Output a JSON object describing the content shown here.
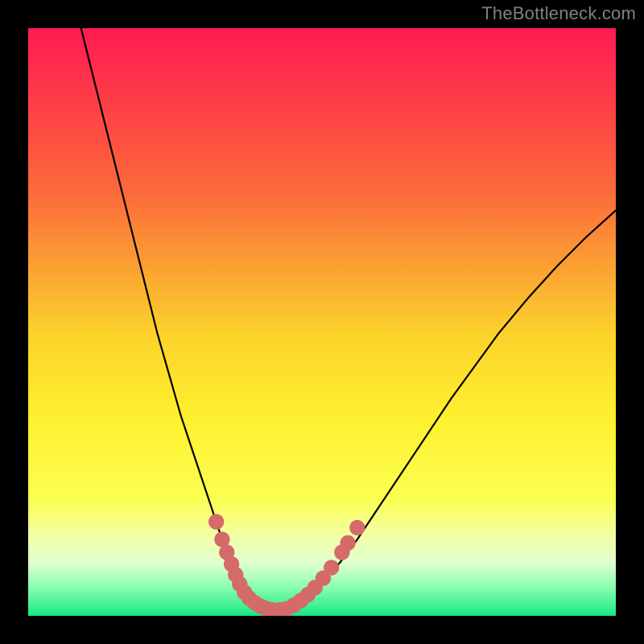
{
  "watermark": "TheBottleneck.com",
  "chart_data": {
    "type": "line",
    "title": "",
    "xlabel": "",
    "ylabel": "",
    "xlim": [
      0,
      100
    ],
    "ylim": [
      0,
      100
    ],
    "grid": false,
    "legend": false,
    "background_gradient": {
      "stops": [
        {
          "pos": 0.0,
          "color": "#ff1a52"
        },
        {
          "pos": 0.28,
          "color": "#fc6a3a"
        },
        {
          "pos": 0.52,
          "color": "#fcd22b"
        },
        {
          "pos": 0.66,
          "color": "#ffef2e"
        },
        {
          "pos": 0.8,
          "color": "#fbff50"
        },
        {
          "pos": 0.86,
          "color": "#f4ffa0"
        },
        {
          "pos": 0.91,
          "color": "#e0ffd0"
        },
        {
          "pos": 0.95,
          "color": "#8cffb0"
        },
        {
          "pos": 1.0,
          "color": "#17e884"
        }
      ]
    },
    "series": [
      {
        "name": "bottleneck-curve",
        "color": "#000000",
        "x": [
          9,
          10,
          12,
          14,
          16,
          18,
          20,
          22,
          24,
          26,
          28,
          30,
          31,
          32,
          33,
          34,
          35,
          36,
          37,
          38,
          39,
          40,
          41,
          42,
          43,
          44,
          46,
          48,
          50,
          53,
          56,
          60,
          64,
          68,
          72,
          76,
          80,
          85,
          90,
          95,
          100
        ],
        "y": [
          100,
          96,
          88,
          80,
          72,
          64,
          56,
          48,
          41,
          34,
          28,
          22,
          19,
          16,
          13,
          10.5,
          8.5,
          6.5,
          5,
          3.7,
          2.7,
          1.9,
          1.3,
          1.0,
          1.0,
          1.2,
          2.0,
          3.5,
          5.5,
          9,
          13,
          19,
          25,
          31,
          37,
          42.5,
          48,
          54,
          59.5,
          64.5,
          69
        ]
      }
    ],
    "markers": {
      "name": "highlight-dots",
      "color": "#d46a6a",
      "points": [
        {
          "x": 32.0,
          "y": 16.0,
          "r": 1.0
        },
        {
          "x": 33.0,
          "y": 13.0,
          "r": 1.0
        },
        {
          "x": 33.8,
          "y": 10.8,
          "r": 1.0
        },
        {
          "x": 34.6,
          "y": 8.8,
          "r": 1.0
        },
        {
          "x": 35.3,
          "y": 7.0,
          "r": 1.0
        },
        {
          "x": 36.0,
          "y": 5.4,
          "r": 1.0
        },
        {
          "x": 36.8,
          "y": 4.0,
          "r": 1.0
        },
        {
          "x": 37.6,
          "y": 3.0,
          "r": 1.0
        },
        {
          "x": 38.6,
          "y": 2.2,
          "r": 1.0
        },
        {
          "x": 39.6,
          "y": 1.6,
          "r": 1.0
        },
        {
          "x": 40.6,
          "y": 1.2,
          "r": 1.0
        },
        {
          "x": 41.6,
          "y": 1.0,
          "r": 1.0
        },
        {
          "x": 42.8,
          "y": 1.0,
          "r": 1.0
        },
        {
          "x": 44.0,
          "y": 1.2,
          "r": 1.0
        },
        {
          "x": 45.2,
          "y": 1.8,
          "r": 1.0
        },
        {
          "x": 46.4,
          "y": 2.6,
          "r": 1.0
        },
        {
          "x": 47.6,
          "y": 3.6,
          "r": 1.0
        },
        {
          "x": 48.8,
          "y": 4.8,
          "r": 1.0
        },
        {
          "x": 50.2,
          "y": 6.4,
          "r": 1.0
        },
        {
          "x": 51.6,
          "y": 8.2,
          "r": 1.0
        },
        {
          "x": 53.4,
          "y": 10.8,
          "r": 1.0
        },
        {
          "x": 54.4,
          "y": 12.4,
          "r": 1.0
        },
        {
          "x": 56.0,
          "y": 15.0,
          "r": 1.0
        }
      ]
    }
  }
}
